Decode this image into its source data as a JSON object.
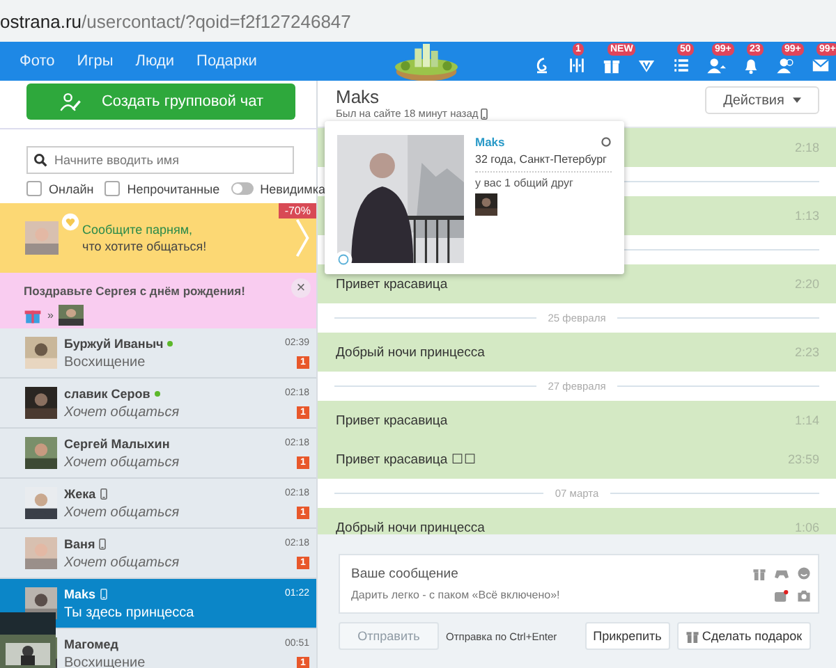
{
  "url": {
    "domain": "ostrana.ru",
    "path": "/usercontact/?qoid=f2f127246847"
  },
  "nav": {
    "links": [
      "Фото",
      "Игры",
      "Люди",
      "Подарки"
    ],
    "icons": [
      {
        "kind": "contest"
      },
      {
        "kind": "equalizer",
        "badge": "1"
      },
      {
        "kind": "gift",
        "badge": "NEW"
      },
      {
        "kind": "v"
      },
      {
        "kind": "list",
        "badge": "50"
      },
      {
        "kind": "user",
        "badge": "99+"
      },
      {
        "kind": "bell",
        "badge": "23"
      },
      {
        "kind": "users",
        "badge": "99+"
      },
      {
        "kind": "mail",
        "badge": "99+"
      }
    ]
  },
  "sidebar": {
    "create_button": "Создать групповой чат",
    "search": {
      "placeholder": "Начните вводить имя"
    },
    "filters": [
      {
        "kind": "checkbox",
        "label": "Онлайн",
        "checked": false
      },
      {
        "kind": "checkbox",
        "label": "Непрочитанные",
        "checked": false
      },
      {
        "kind": "toggle",
        "label": "Невидимка",
        "checked": false
      }
    ],
    "promo": {
      "discount": "-70%",
      "line1": "Сообщите парням,",
      "line2": "что хотите общаться!"
    },
    "birthday": {
      "text": "Поздравьте Сергея с днём рождения!",
      "arrow": "»",
      "close": "×"
    },
    "contacts": [
      {
        "name": "Буржуй Иваныч",
        "online": true,
        "mobile": false,
        "time": "02:39",
        "preview": "Восхищение",
        "italic": false,
        "badge": "1",
        "selected": false
      },
      {
        "name": "славик Серов",
        "online": true,
        "mobile": false,
        "time": "02:18",
        "preview": "Хочет общаться",
        "italic": true,
        "badge": "1",
        "selected": false
      },
      {
        "name": "Сергей Малыхин",
        "online": false,
        "mobile": false,
        "time": "02:18",
        "preview": "Хочет общаться",
        "italic": true,
        "badge": "1",
        "selected": false
      },
      {
        "name": "Жека",
        "online": false,
        "mobile": true,
        "time": "02:18",
        "preview": "Хочет общаться",
        "italic": true,
        "badge": "1",
        "selected": false
      },
      {
        "name": "Ваня",
        "online": false,
        "mobile": true,
        "time": "02:18",
        "preview": "Хочет общаться",
        "italic": true,
        "badge": "1",
        "selected": false
      },
      {
        "name": "Maks",
        "online": false,
        "mobile": true,
        "time": "01:22",
        "preview": "Ты здесь принцесса",
        "italic": false,
        "selected": true
      },
      {
        "name": "Магомед",
        "online": false,
        "mobile": false,
        "time": "00:51",
        "preview": "Восхищение",
        "italic": false,
        "badge": "1",
        "selected": false
      }
    ]
  },
  "chat": {
    "name": "Maks",
    "status": "Был на сайте 18 минут назад",
    "mobile": true,
    "actions": "Действия",
    "messages": [
      {
        "kind": "message",
        "time": "2:18"
      },
      {
        "kind": "gap"
      },
      {
        "kind": "message",
        "time": "1:13"
      },
      {
        "kind": "gap"
      },
      {
        "kind": "message",
        "text": "Привет красавица",
        "time": "2:20"
      },
      {
        "kind": "date",
        "text": "25 февраля"
      },
      {
        "kind": "message",
        "text": "Добрый ночи принцесса",
        "time": "2:23"
      },
      {
        "kind": "date",
        "text": "27 февраля"
      },
      {
        "kind": "message",
        "text": "Привет красавица",
        "time": "1:14"
      },
      {
        "kind": "message",
        "text": "Привет красавица ☐☐",
        "time": "23:59"
      },
      {
        "kind": "date",
        "text": "07 марта"
      },
      {
        "kind": "message",
        "text": "Добрый ночи принцесса",
        "time": "1:06"
      }
    ],
    "profile_popup": {
      "name": "Maks",
      "info": "32 года, Санкт-Петербург",
      "friends": "у вас 1 общий друг"
    },
    "composer": {
      "placeholder": "Ваше сообщение",
      "promo": "Дарить легко - с паком «Всё включено»!",
      "send": {
        "label": "Отправить",
        "disabled": true
      },
      "hint": "Отправка по Ctrl+Enter",
      "attach": "Прикрепить",
      "gift": "Сделать подарок"
    }
  }
}
